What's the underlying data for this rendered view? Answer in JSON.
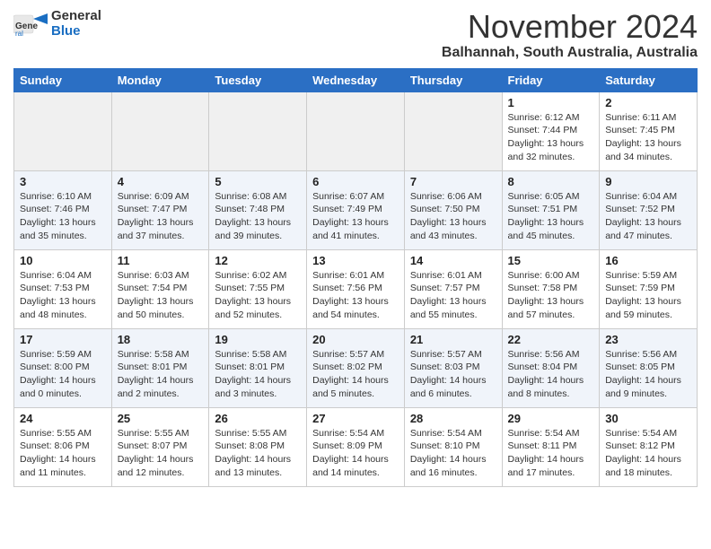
{
  "header": {
    "logo_line1": "General",
    "logo_line2": "Blue",
    "month": "November 2024",
    "location": "Balhannah, South Australia, Australia"
  },
  "days_of_week": [
    "Sunday",
    "Monday",
    "Tuesday",
    "Wednesday",
    "Thursday",
    "Friday",
    "Saturday"
  ],
  "weeks": [
    [
      {
        "day": "",
        "info": "",
        "empty": true
      },
      {
        "day": "",
        "info": "",
        "empty": true
      },
      {
        "day": "",
        "info": "",
        "empty": true
      },
      {
        "day": "",
        "info": "",
        "empty": true
      },
      {
        "day": "",
        "info": "",
        "empty": true
      },
      {
        "day": "1",
        "info": "Sunrise: 6:12 AM\nSunset: 7:44 PM\nDaylight: 13 hours\nand 32 minutes.",
        "empty": false
      },
      {
        "day": "2",
        "info": "Sunrise: 6:11 AM\nSunset: 7:45 PM\nDaylight: 13 hours\nand 34 minutes.",
        "empty": false
      }
    ],
    [
      {
        "day": "3",
        "info": "Sunrise: 6:10 AM\nSunset: 7:46 PM\nDaylight: 13 hours\nand 35 minutes.",
        "empty": false
      },
      {
        "day": "4",
        "info": "Sunrise: 6:09 AM\nSunset: 7:47 PM\nDaylight: 13 hours\nand 37 minutes.",
        "empty": false
      },
      {
        "day": "5",
        "info": "Sunrise: 6:08 AM\nSunset: 7:48 PM\nDaylight: 13 hours\nand 39 minutes.",
        "empty": false
      },
      {
        "day": "6",
        "info": "Sunrise: 6:07 AM\nSunset: 7:49 PM\nDaylight: 13 hours\nand 41 minutes.",
        "empty": false
      },
      {
        "day": "7",
        "info": "Sunrise: 6:06 AM\nSunset: 7:50 PM\nDaylight: 13 hours\nand 43 minutes.",
        "empty": false
      },
      {
        "day": "8",
        "info": "Sunrise: 6:05 AM\nSunset: 7:51 PM\nDaylight: 13 hours\nand 45 minutes.",
        "empty": false
      },
      {
        "day": "9",
        "info": "Sunrise: 6:04 AM\nSunset: 7:52 PM\nDaylight: 13 hours\nand 47 minutes.",
        "empty": false
      }
    ],
    [
      {
        "day": "10",
        "info": "Sunrise: 6:04 AM\nSunset: 7:53 PM\nDaylight: 13 hours\nand 48 minutes.",
        "empty": false
      },
      {
        "day": "11",
        "info": "Sunrise: 6:03 AM\nSunset: 7:54 PM\nDaylight: 13 hours\nand 50 minutes.",
        "empty": false
      },
      {
        "day": "12",
        "info": "Sunrise: 6:02 AM\nSunset: 7:55 PM\nDaylight: 13 hours\nand 52 minutes.",
        "empty": false
      },
      {
        "day": "13",
        "info": "Sunrise: 6:01 AM\nSunset: 7:56 PM\nDaylight: 13 hours\nand 54 minutes.",
        "empty": false
      },
      {
        "day": "14",
        "info": "Sunrise: 6:01 AM\nSunset: 7:57 PM\nDaylight: 13 hours\nand 55 minutes.",
        "empty": false
      },
      {
        "day": "15",
        "info": "Sunrise: 6:00 AM\nSunset: 7:58 PM\nDaylight: 13 hours\nand 57 minutes.",
        "empty": false
      },
      {
        "day": "16",
        "info": "Sunrise: 5:59 AM\nSunset: 7:59 PM\nDaylight: 13 hours\nand 59 minutes.",
        "empty": false
      }
    ],
    [
      {
        "day": "17",
        "info": "Sunrise: 5:59 AM\nSunset: 8:00 PM\nDaylight: 14 hours\nand 0 minutes.",
        "empty": false
      },
      {
        "day": "18",
        "info": "Sunrise: 5:58 AM\nSunset: 8:01 PM\nDaylight: 14 hours\nand 2 minutes.",
        "empty": false
      },
      {
        "day": "19",
        "info": "Sunrise: 5:58 AM\nSunset: 8:01 PM\nDaylight: 14 hours\nand 3 minutes.",
        "empty": false
      },
      {
        "day": "20",
        "info": "Sunrise: 5:57 AM\nSunset: 8:02 PM\nDaylight: 14 hours\nand 5 minutes.",
        "empty": false
      },
      {
        "day": "21",
        "info": "Sunrise: 5:57 AM\nSunset: 8:03 PM\nDaylight: 14 hours\nand 6 minutes.",
        "empty": false
      },
      {
        "day": "22",
        "info": "Sunrise: 5:56 AM\nSunset: 8:04 PM\nDaylight: 14 hours\nand 8 minutes.",
        "empty": false
      },
      {
        "day": "23",
        "info": "Sunrise: 5:56 AM\nSunset: 8:05 PM\nDaylight: 14 hours\nand 9 minutes.",
        "empty": false
      }
    ],
    [
      {
        "day": "24",
        "info": "Sunrise: 5:55 AM\nSunset: 8:06 PM\nDaylight: 14 hours\nand 11 minutes.",
        "empty": false
      },
      {
        "day": "25",
        "info": "Sunrise: 5:55 AM\nSunset: 8:07 PM\nDaylight: 14 hours\nand 12 minutes.",
        "empty": false
      },
      {
        "day": "26",
        "info": "Sunrise: 5:55 AM\nSunset: 8:08 PM\nDaylight: 14 hours\nand 13 minutes.",
        "empty": false
      },
      {
        "day": "27",
        "info": "Sunrise: 5:54 AM\nSunset: 8:09 PM\nDaylight: 14 hours\nand 14 minutes.",
        "empty": false
      },
      {
        "day": "28",
        "info": "Sunrise: 5:54 AM\nSunset: 8:10 PM\nDaylight: 14 hours\nand 16 minutes.",
        "empty": false
      },
      {
        "day": "29",
        "info": "Sunrise: 5:54 AM\nSunset: 8:11 PM\nDaylight: 14 hours\nand 17 minutes.",
        "empty": false
      },
      {
        "day": "30",
        "info": "Sunrise: 5:54 AM\nSunset: 8:12 PM\nDaylight: 14 hours\nand 18 minutes.",
        "empty": false
      }
    ]
  ]
}
